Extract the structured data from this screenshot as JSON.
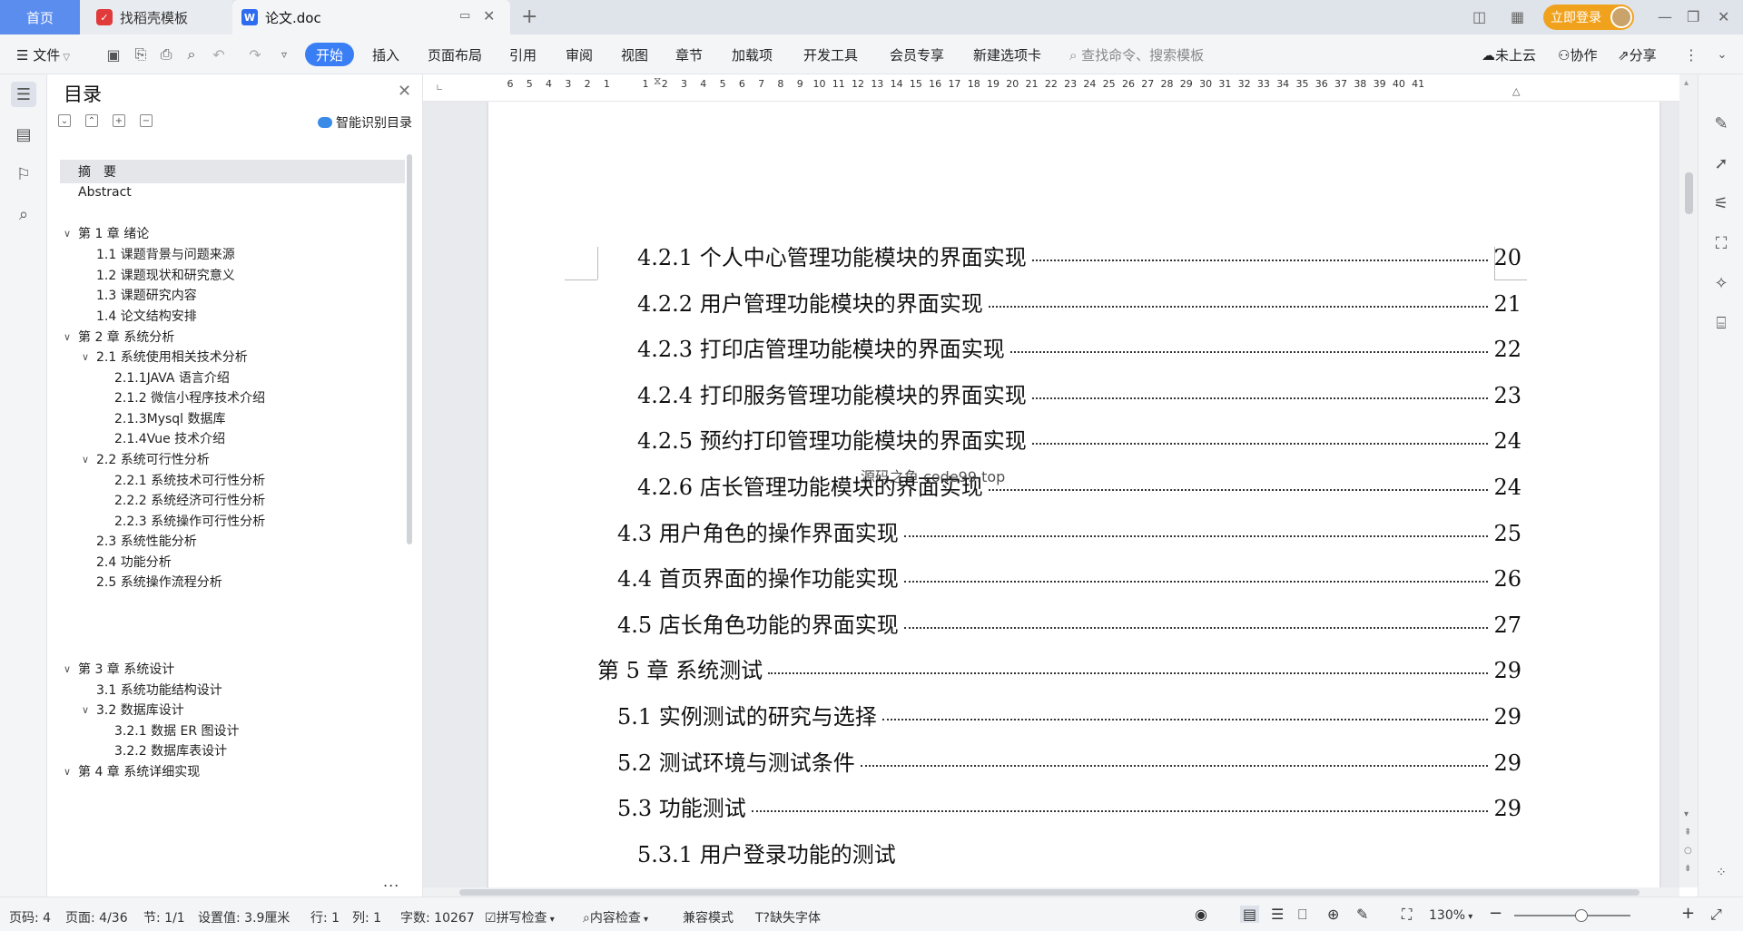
{
  "titlebar": {
    "tabs": [
      {
        "label": "首页"
      },
      {
        "label": "找稻壳模板"
      },
      {
        "label": "论文.doc"
      }
    ],
    "login_label": "立即登录"
  },
  "menubar": {
    "file_label": "文件",
    "tabs": [
      "开始",
      "插入",
      "页面布局",
      "引用",
      "审阅",
      "视图",
      "章节",
      "加载项",
      "开发工具",
      "会员专享",
      "新建选项卡"
    ],
    "search_placeholder": "查找命令、搜索模板",
    "cloud_label": "未上云",
    "collab_label": "协作",
    "share_label": "分享"
  },
  "toc_panel": {
    "title": "目录",
    "smart_label": "智能识别目录",
    "more_label": "...",
    "items": [
      {
        "label": "摘　要",
        "level": 0,
        "selected": true
      },
      {
        "label": "Abstract",
        "level": 0
      },
      {
        "label": "第 1 章  绪论",
        "level": 0,
        "expanded": true
      },
      {
        "label": "1.1 课题背景与问题来源",
        "level": 1
      },
      {
        "label": "1.2 课题现状和研究意义",
        "level": 1
      },
      {
        "label": "1.3 课题研究内容",
        "level": 1
      },
      {
        "label": "1.4 论文结构安排",
        "level": 1
      },
      {
        "label": "第 2 章  系统分析",
        "level": 0,
        "expanded": true
      },
      {
        "label": "2.1 系统使用相关技术分析",
        "level": 1,
        "expanded": true
      },
      {
        "label": "2.1.1JAVA 语言介绍",
        "level": 2
      },
      {
        "label": "2.1.2 微信小程序技术介绍",
        "level": 2
      },
      {
        "label": "2.1.3Mysql 数据库",
        "level": 2
      },
      {
        "label": "2.1.4Vue 技术介绍",
        "level": 2
      },
      {
        "label": "2.2 系统可行性分析",
        "level": 1,
        "expanded": true
      },
      {
        "label": "2.2.1 系统技术可行性分析",
        "level": 2
      },
      {
        "label": "2.2.2 系统经济可行性分析",
        "level": 2
      },
      {
        "label": "2.2.3 系统操作可行性分析",
        "level": 2
      },
      {
        "label": "2.3 系统性能分析",
        "level": 1
      },
      {
        "label": "2.4 功能分析",
        "level": 1
      },
      {
        "label": "2.5 系统操作流程分析",
        "level": 1
      },
      {
        "label": "第 3 章  系统设计",
        "level": 0,
        "expanded": true
      },
      {
        "label": "3.1 系统功能结构设计",
        "level": 1
      },
      {
        "label": "3.2 数据库设计",
        "level": 1,
        "expanded": true
      },
      {
        "label": "3.2.1 数据 ER 图设计",
        "level": 2
      },
      {
        "label": "3.2.2 数据库表设计",
        "level": 2
      },
      {
        "label": "第 4 章  系统详细实现",
        "level": 0,
        "expanded": true
      }
    ]
  },
  "ruler": {
    "ticks": [
      "6",
      "5",
      "4",
      "3",
      "2",
      "1",
      "",
      "1",
      "2",
      "3",
      "4",
      "5",
      "6",
      "7",
      "8",
      "9",
      "10",
      "11",
      "12",
      "13",
      "14",
      "15",
      "16",
      "17",
      "18",
      "19",
      "20",
      "21",
      "22",
      "23",
      "24",
      "25",
      "26",
      "27",
      "28",
      "29",
      "30",
      "31",
      "32",
      "33",
      "34",
      "35",
      "36",
      "37",
      "38",
      "39",
      "40",
      "41"
    ]
  },
  "document": {
    "watermark": "源码之鱼 code99.top",
    "toc_lines": [
      {
        "text": "4.2.1 个人中心管理功能模块的界面实现",
        "page": "20",
        "indent": 2
      },
      {
        "text": "4.2.2 用户管理功能模块的界面实现",
        "page": "21",
        "indent": 2
      },
      {
        "text": "4.2.3 打印店管理功能模块的界面实现",
        "page": "22",
        "indent": 2
      },
      {
        "text": "4.2.4 打印服务管理功能模块的界面实现",
        "page": "23",
        "indent": 2
      },
      {
        "text": "4.2.5 预约打印管理功能模块的界面实现",
        "page": "24",
        "indent": 2
      },
      {
        "text": "4.2.6 店长管理功能模块的界面实现",
        "page": "24",
        "indent": 2
      },
      {
        "text": "4.3 用户角色的操作界面实现",
        "page": "25",
        "indent": 1
      },
      {
        "text": "4.4 首页界面的操作功能实现",
        "page": "26",
        "indent": 1
      },
      {
        "text": "4.5 店长角色功能的界面实现",
        "page": "27",
        "indent": 1
      },
      {
        "text": "第 5 章  系统测试",
        "page": "29",
        "indent": 0
      },
      {
        "text": "5.1 实例测试的研究与选择",
        "page": "29",
        "indent": 1
      },
      {
        "text": "5.2 测试环境与测试条件",
        "page": "29",
        "indent": 1
      },
      {
        "text": "5.3 功能测试",
        "page": "29",
        "indent": 1
      },
      {
        "text": "5.3.1 用户登录功能的测试",
        "page": "",
        "indent": 2
      }
    ]
  },
  "statusbar": {
    "page_num": "页码: 4",
    "pages": "页面: 4/36",
    "section": "节: 1/1",
    "setting": "设置值: 3.9厘米",
    "row": "行: 1",
    "col": "列: 1",
    "words": "字数: 10267",
    "spell": "拼写检查",
    "content_check": "内容检查",
    "compat": "兼容模式",
    "missing_font": "缺失字体",
    "zoom": "130%",
    "zoom_level_fraction": 0.58
  },
  "colors": {
    "accent": "#3a7ef5",
    "home_tab": "#5b8def",
    "login": "#f0a21c"
  }
}
